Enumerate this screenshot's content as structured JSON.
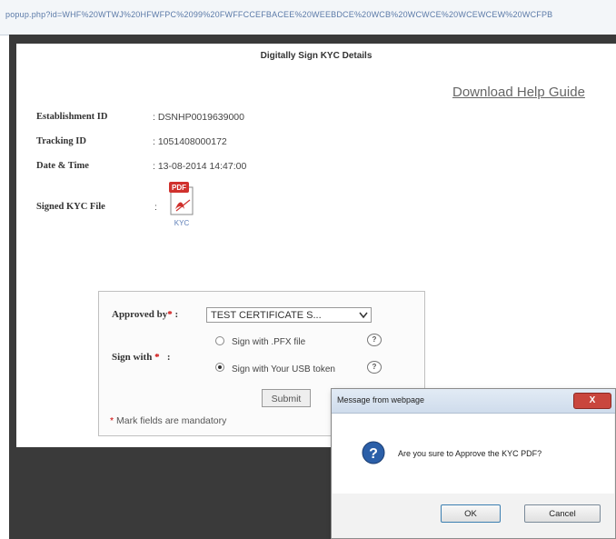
{
  "browser": {
    "url": "popup.php?id=WHF%20WTWJ%20HFWFPC%2099%20FWFFCCEFBACEE%20WEEBDCE%20WCB%20WCWCE%20WCEWCEW%20WCFPBE"
  },
  "page": {
    "title": "Digitally Sign KYC Details",
    "help_link": "Download Help Guide",
    "fields": [
      {
        "label": "Establishment ID",
        "value": ": DSNHP0019639000"
      },
      {
        "label": "Tracking ID",
        "value": ": 1051408000172"
      },
      {
        "label": "Date & Time",
        "value": ": 13-08-2014 14:47:00"
      },
      {
        "label": "Signed KYC File",
        "value": ":"
      }
    ],
    "pdf_icon": {
      "badge": "PDF",
      "caption": "KYC",
      "icon": "pdf-file-icon"
    }
  },
  "approval": {
    "approved_by_label": "Approved by",
    "required_mark": "*",
    "colon": ":",
    "selected_certificate": "TEST CERTIFICATE S...",
    "sign_with_label": "Sign with",
    "options": [
      {
        "label": "Sign with .PFX file",
        "checked": false
      },
      {
        "label": "Sign with Your USB token",
        "checked": true
      }
    ],
    "help_icon": "?",
    "submit_label": "Submit",
    "mandatory_note": " Mark fields are mandatory"
  },
  "dialog": {
    "title": "Message from webpage",
    "close_label": "X",
    "message": "Are you sure to Approve the KYC PDF?",
    "icon": "question-icon",
    "ok_label": "OK",
    "cancel_label": "Cancel"
  }
}
